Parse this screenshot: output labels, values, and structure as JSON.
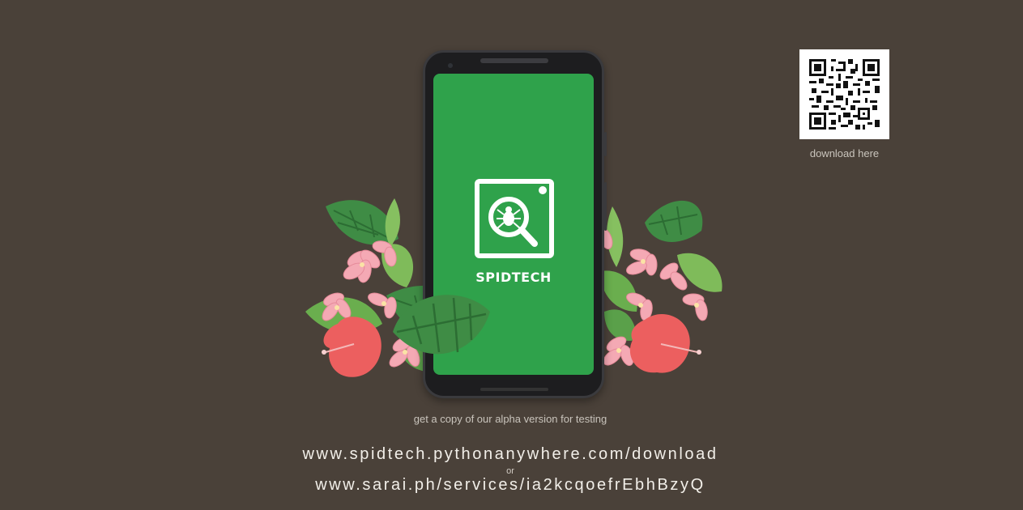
{
  "app": {
    "name": "SPIDTECH",
    "brand_color": "#2fa24b",
    "icon": "bug-magnifier-icon"
  },
  "qr": {
    "caption": "download here",
    "icon": "qr-code-icon"
  },
  "tagline": "get a copy of our alpha version for testing",
  "links": {
    "primary": "www.spidtech.pythonanywhere.com/download",
    "separator": "or",
    "secondary": "www.sarai.ph/services/ia2kcqoefrEbhBzyQ"
  },
  "colors": {
    "background": "#4a4139",
    "flower_pink": "#f2a1ad",
    "hibiscus_red": "#ec5f5f",
    "leaf_green": "#3f8c45"
  }
}
